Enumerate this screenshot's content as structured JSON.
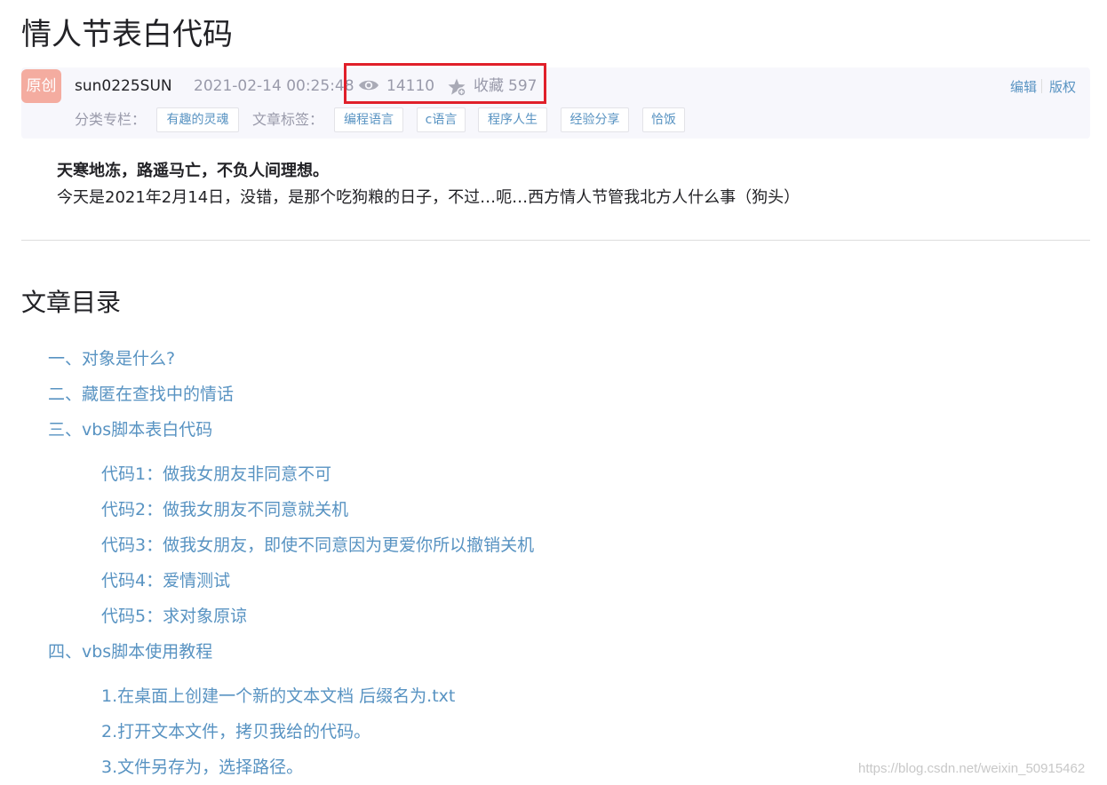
{
  "article": {
    "title": "情人节表白代码",
    "badge": "原创",
    "author": "sun0225SUN",
    "date": "2021-02-14 00:25:48",
    "views": "14110",
    "collect_label": "收藏",
    "collect_count": "597",
    "edit_label": "编辑",
    "copyright_label": "版权",
    "category_label": "分类专栏：",
    "category": "有趣的灵魂",
    "tags_label": "文章标签：",
    "tags": [
      "编程语言",
      "c语言",
      "程序人生",
      "经验分享",
      "恰饭"
    ],
    "lead_bold": "天寒地冻，路遥马亡，不负人间理想。",
    "lead_text": "今天是2021年2月14日，没错，是那个吃狗粮的日子，不过…呃…西方情人节管我北方人什么事（狗头）"
  },
  "toc": {
    "title": "文章目录",
    "items": [
      "一、对象是什么?",
      "二、藏匿在查找中的情话",
      "三、vbs脚本表白代码",
      "代码1：做我女朋友非同意不可",
      "代码2：做我女朋友不同意就关机",
      "代码3：做我女朋友，即使不同意因为更爱你所以撤销关机",
      "代码4：爱情测试",
      "代码5：求对象原谅",
      "四、vbs脚本使用教程",
      "1.在桌面上创建一个新的文本文档 后缀名为.txt",
      "2.打开文本文件，拷贝我给的代码。",
      "3.文件另存为，选择路径。"
    ]
  },
  "watermark": "https://blog.csdn.net/weixin_50915462",
  "colors": {
    "link": "#5893c2",
    "badge": "#f4aca0",
    "highlight_border": "#e0202a",
    "meta_bg": "#f7f7fc"
  },
  "icons": {
    "views": "eye-icon",
    "collect": "star-icon"
  }
}
